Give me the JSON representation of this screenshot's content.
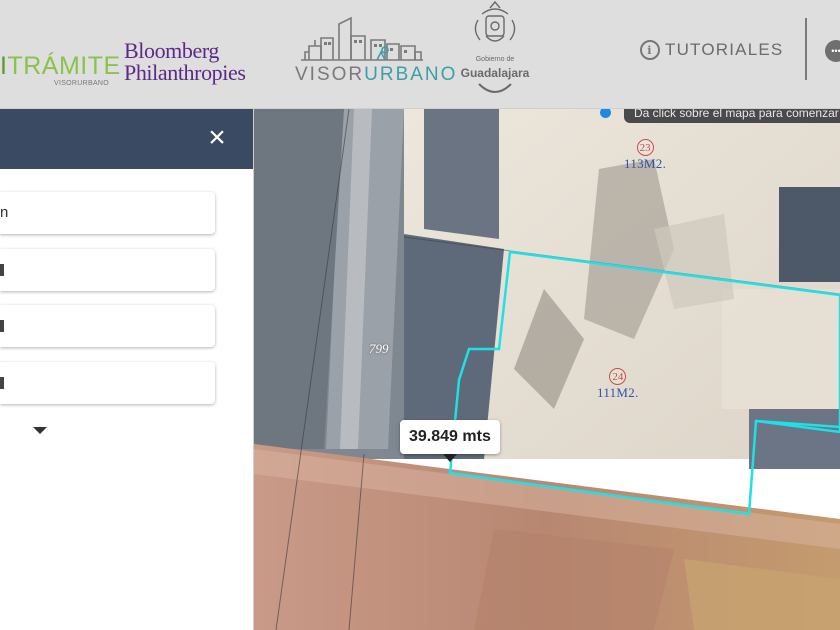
{
  "header": {
    "logo_mitramite": {
      "prefix": "I",
      "main": "TRÁMITE",
      "sub": "VISORURBANO"
    },
    "logo_bloomberg": {
      "line1": "Bloomberg",
      "line2": "Philanthropies"
    },
    "logo_visor": {
      "part1": "VISOR",
      "part2": "URBANO"
    },
    "logo_gdl": {
      "line1": "Gobierno de",
      "line2": "Guadalajara"
    },
    "tutoriales_label": "TUTORIALES",
    "tutoriales_icon": "info-circle-icon",
    "chat_icon": "chat-bubble-icon"
  },
  "panel": {
    "close_label": "×",
    "fields": [
      {
        "value": "n"
      },
      {
        "value": ""
      },
      {
        "value": ""
      },
      {
        "value": ""
      }
    ],
    "expand_icon": "caret-down-icon"
  },
  "map": {
    "hint": "Da click sobre el mapa para comenzar",
    "lots": [
      {
        "number": "23",
        "area": "113M2."
      },
      {
        "number": "24",
        "area": "111M2."
      }
    ],
    "street_number": "799",
    "measure_label": "39.849 mts",
    "colors": {
      "parcel_outline": "#1ee0e8",
      "hint_dot": "#1e88e5",
      "label_area": "#2f53a8",
      "label_num": "#c0504d"
    }
  }
}
